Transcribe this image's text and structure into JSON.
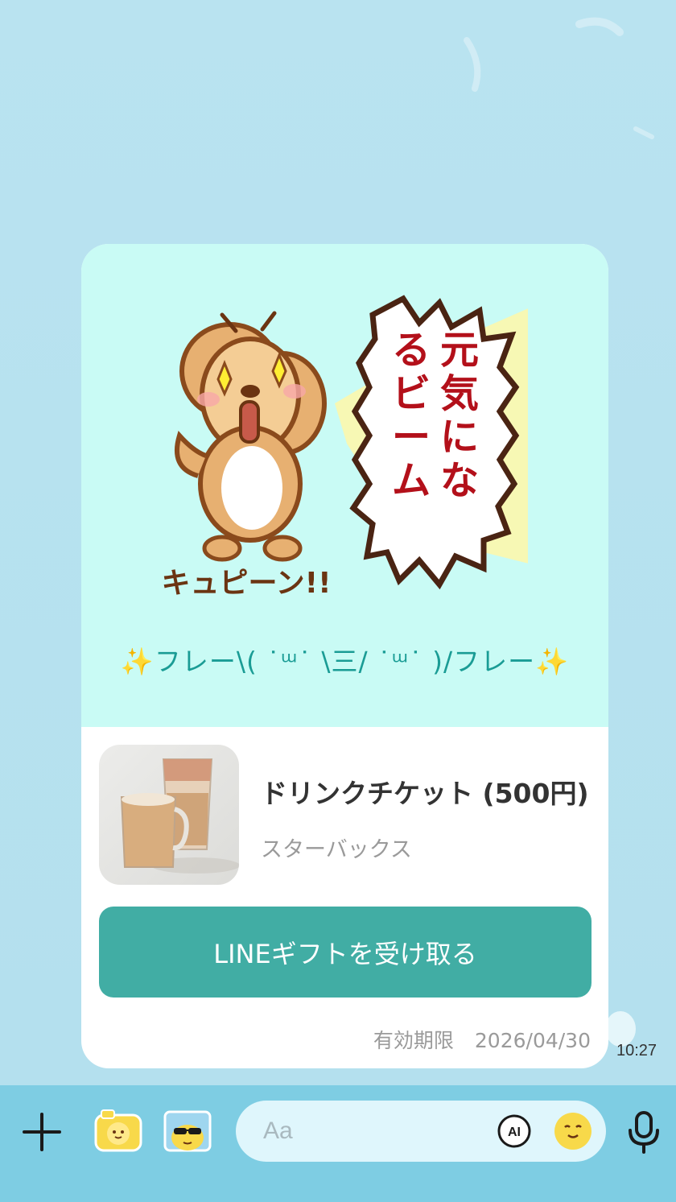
{
  "chat": {
    "sticker": {
      "speech_text": "元気になるビーム",
      "sound_text": "キュピーン!!"
    },
    "message": "✨フレー\\( ˙ᵚ˙ \\三/ ˙ᵚ˙ )/フレー✨",
    "gift": {
      "name": "ドリンクチケット (500円)",
      "brand": "スターバックス",
      "receive_button": "LINEギフトを受け取る",
      "expiry_label": "有効期限",
      "expiry_date": "2026/04/30"
    },
    "time": "10:27"
  },
  "input_bar": {
    "placeholder": "Aa",
    "ai_label": "AI"
  },
  "colors": {
    "chat_background": "#b7e2ef",
    "card_top": "#c9fbf5",
    "button": "#41ada4",
    "bottom_bar": "#7ecde3",
    "message_text": "#1a9c95"
  },
  "icons": {
    "plus": "plus-icon",
    "camera": "camera-icon",
    "photo": "photo-icon",
    "ai": "ai-icon",
    "emoji": "emoji-icon",
    "mic": "microphone-icon"
  }
}
